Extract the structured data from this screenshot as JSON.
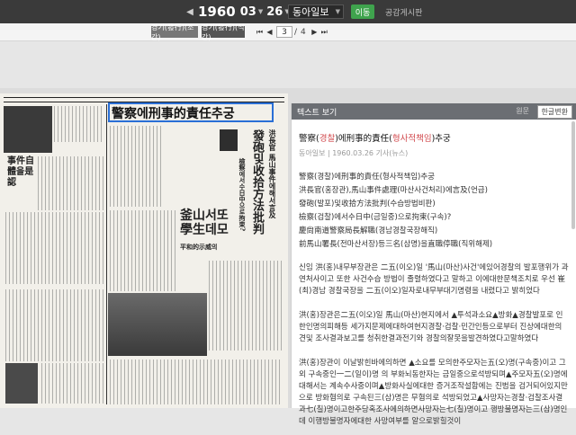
{
  "topbar": {
    "year": "1960",
    "month": "03",
    "day": "26",
    "paper": "동아일보",
    "go_label": "이동",
    "notice": "공감게시판"
  },
  "subbar": {
    "tab_a": "경기(發行)(조간)",
    "tab_b": "경기(發行)(석간)",
    "page_current": "3",
    "page_sep": "/",
    "page_total": "4"
  },
  "newspaper": {
    "headline": "警察에刑事的責任추궁",
    "sub1": "發砲및收拾方法批判",
    "sub2": "釜山서또學生데모",
    "side1": "事件自體을是認",
    "vert1": "洪長官 馬山事件에해서言及",
    "vert2": "檢察에서수日中으로拘束?",
    "small1": "平和的示威의",
    "box_label": "警察에刑事的責任추궁"
  },
  "panel": {
    "header": "텍스트 보기",
    "orig_label": "원문",
    "convert_label": "한글변환",
    "title_pre": "警察(",
    "title_han1": "경찰",
    "title_mid": ")에刑事的責任(",
    "title_han2": "형사적책임",
    "title_post": ")추궁",
    "meta": "동아일보 | 1960.03.26 기사(뉴스)",
    "lines": [
      "警察(경찰)에刑事的責任(형사적책임)추궁",
      "洪長官(홍장관),馬山事件處理(마산사건처리)에言及(언급)",
      "發砲(발포)및收拾方法批判(수습방법비판)",
      "檢察(검찰)에서수日中(금일중)으로拘束(구속)?",
      "慶尙南道警察局長解職(경남경찰국장해직)",
      "前馬山署長(전마산서장)등三名(삼명)을直職停職(직위해제)"
    ],
    "para1": "신임 洪(홍)내무부장관은 二五(이오)일 '馬山(마산)사건'에있어경찰의 발포행위가 과연처사이고 또한 사건수습 방법이 졸렬하였다고 말하고 이에대한문책조치로 우선 崔(최)경남 경찰국장을 二五(이오)일자로내무부대기명령을 내렸다고 밝히었다",
    "para2": "洪(홍)장관은二五(이오)일 馬山(마산)현지에서 ▲투석과소요▲방화▲경찰발포로 인한인명의피해등 세가지문제에대하여현지경찰·검찰·민간인등으로부터 진상에대한의견및 조사결과보고를 청취한결과전기와 경찰의잘못을발견하였다고말하였다",
    "para3": "洪(홍)장관이 이날밝힌바에의하면 ▲소요를 모의한주모자는五(오)명(구속중)이고 그외 구속중인一二(일이)명 의 부화뇌동한자는 금일중으로석방되며▲주모자五(오)명에대해서는 계속수사중이며▲방화사실에대한 증거조작설함에는 진범을 검거되어있지만으로 방화혐의로 구속된三(삼)명은 무혐의로 석방되었고▲사망자는경찰·검찰조사결과七(칠)명이고한주당혹조사에의하면사망자는七(칠)명이고 행방불명자는三(삼)명인데 이행방불명자에대한 사망여부를 알으로밝힐것이"
  }
}
